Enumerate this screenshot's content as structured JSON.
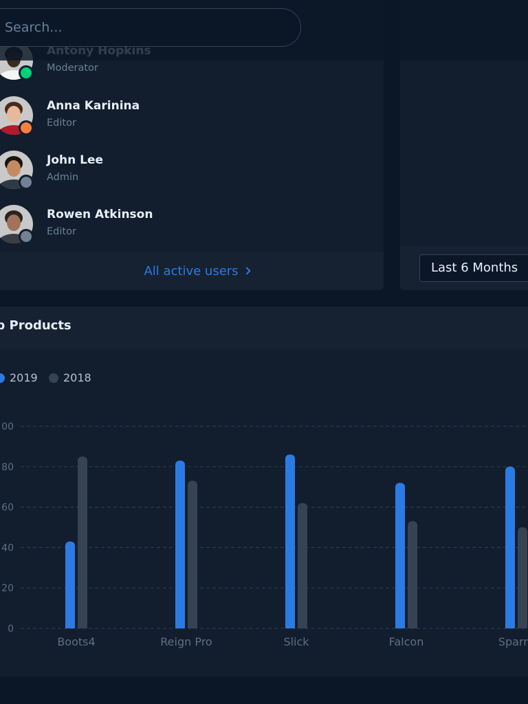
{
  "search": {
    "placeholder": "Search..."
  },
  "users": {
    "items": [
      {
        "name": "Antony Hopkins",
        "role": "Moderator",
        "status_color": "#00d27a",
        "skin": "#3a2b22",
        "shirt": "#f4f4f4",
        "hair": "#1b1b1b"
      },
      {
        "name": "Anna Karinina",
        "role": "Editor",
        "status_color": "#f5803e",
        "skin": "#e8b89b",
        "shirt": "#b3192c",
        "hair": "#4b2a1a"
      },
      {
        "name": "John Lee",
        "role": "Admin",
        "status_color": "#748194",
        "skin": "#c48a62",
        "shirt": "#2e3a46",
        "hair": "#1a1410"
      },
      {
        "name": "Rowen Atkinson",
        "role": "Editor",
        "status_color": "#748194",
        "skin": "#a0735a",
        "shirt": "#3a3e44",
        "hair": "#2a2420"
      }
    ],
    "footer_link": "All active users"
  },
  "revenue": {
    "period_select": "Last 6 Months"
  },
  "products": {
    "title": "op Products",
    "legend": [
      {
        "label": "2019",
        "color": "#2c7be5"
      },
      {
        "label": "2018",
        "color": "#364353"
      }
    ]
  },
  "chart_data": {
    "type": "bar",
    "categories": [
      "Boots4",
      "Reign Pro",
      "Slick",
      "Falcon",
      "Sparro"
    ],
    "series": [
      {
        "name": "2019",
        "values": [
          43,
          83,
          86,
          72,
          80
        ],
        "color": "#2c7be5"
      },
      {
        "name": "2018",
        "values": [
          85,
          73,
          62,
          53,
          50
        ],
        "color": "#364353"
      }
    ],
    "ylim": [
      0,
      100
    ],
    "y_ticks": [
      "0",
      "20",
      "40",
      "60",
      "80",
      "00"
    ],
    "grid": true,
    "legend_position": "top-left"
  }
}
